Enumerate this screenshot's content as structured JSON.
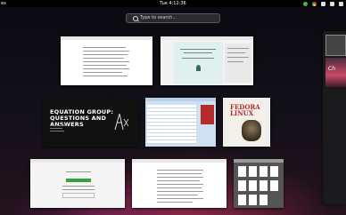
{
  "topbar": {
    "activities_label": "es",
    "clock": "Tue 4:12:36",
    "tray_icons": [
      "notification-icon",
      "chrome-icon",
      "network-icon",
      "volume-icon",
      "battery-icon"
    ]
  },
  "search": {
    "placeholder": "Type to search…"
  },
  "windows": [
    {
      "name": "document-window-1"
    },
    {
      "name": "document-window-2"
    },
    {
      "name": "presentation-window",
      "title_text": "EQUATION GROUP:\nQUESTIONS AND\nANSWERS"
    },
    {
      "name": "spreadsheet-window"
    },
    {
      "name": "fedora-linux-book-window",
      "title_text": "FEDORA\nLINUX"
    },
    {
      "name": "browser-window"
    },
    {
      "name": "writer-window"
    },
    {
      "name": "file-manager-window"
    }
  ],
  "workspace": {
    "thumb_caption": "Ch"
  },
  "colors": {
    "topbar": "#000000",
    "accent_green": "#37a03c",
    "fedora_red": "#b42b2b"
  }
}
